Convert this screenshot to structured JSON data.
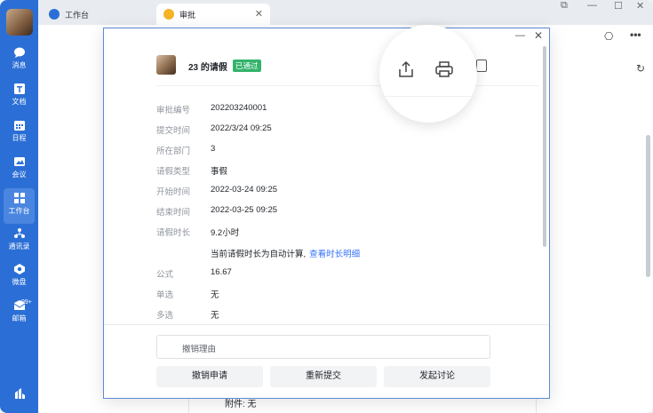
{
  "window": {
    "tabs": [
      {
        "label": "工作台",
        "active": false
      },
      {
        "label": "审批",
        "active": true
      }
    ]
  },
  "sidebar": {
    "items": [
      {
        "label": "消息",
        "icon": "chat-bubble-icon"
      },
      {
        "label": "文档",
        "icon": "document-icon"
      },
      {
        "label": "日程",
        "icon": "calendar-icon"
      },
      {
        "label": "会议",
        "icon": "video-icon"
      },
      {
        "label": "工作台",
        "icon": "grid-icon",
        "active": true
      },
      {
        "label": "通讯录",
        "icon": "contacts-icon"
      },
      {
        "label": "微盘",
        "icon": "drive-icon"
      },
      {
        "label": "邮箱",
        "icon": "mail-icon",
        "badge": "99+"
      }
    ]
  },
  "dialog": {
    "title": "23 的请假",
    "status": "已通过",
    "fields": [
      {
        "key": "审批编号",
        "value": "202203240001"
      },
      {
        "key": "提交时间",
        "value": "2022/3/24 09:25"
      },
      {
        "key": "所在部门",
        "value": "3"
      },
      {
        "key": "请假类型",
        "value": "事假"
      },
      {
        "key": "开始时间",
        "value": "2022-03-24 09:25"
      },
      {
        "key": "结束时间",
        "value": "2022-03-25 09:25"
      },
      {
        "key": "请假时长",
        "value": "9.2小时"
      }
    ],
    "hint_text": "当前请假时长为自动计算,",
    "hint_link": "查看时长明细",
    "extra_fields": [
      {
        "key": "公式",
        "value": "16.67"
      },
      {
        "key": "单选",
        "value": "无"
      },
      {
        "key": "多选",
        "value": "无"
      }
    ],
    "reason_placeholder": "撤销理由",
    "buttons": [
      "撤销申请",
      "重新提交",
      "发起讨论"
    ]
  },
  "behind_text": "附件: 无",
  "colors": {
    "sidebar": "#2b6fd6",
    "status": "#33b36b",
    "link": "#3370ff"
  }
}
